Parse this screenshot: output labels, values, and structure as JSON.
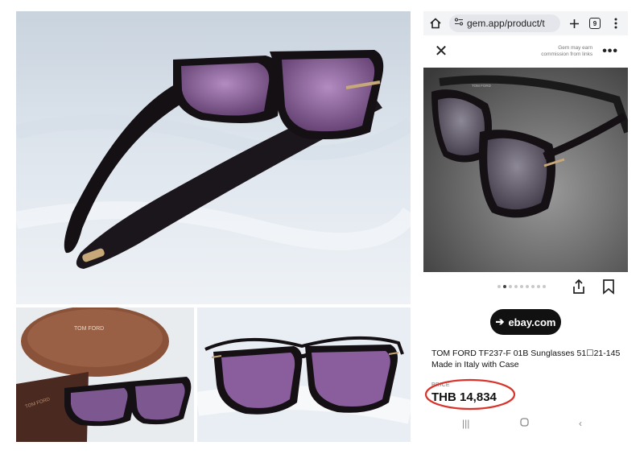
{
  "browser": {
    "url": "gem.app/product/t",
    "tab_count": "9"
  },
  "sheet": {
    "commission_line1": "Gem may earn",
    "commission_line2": "commission from links"
  },
  "carousel": {
    "dot_count": 9,
    "active_index": 1
  },
  "product": {
    "source_button": "ebay.com",
    "title_line1": "TOM FORD TF237-F 01B Sunglasses 51☐21-145",
    "title_line2": "Made in Italy with Case",
    "price_label": "PRICE",
    "price_value": "THB 14,834"
  },
  "case_photo": {
    "brand_text": "TOM FORD"
  },
  "colors": {
    "annotation_circle": "#d9342b",
    "frame": "#141014",
    "lens": "#6e4a7e",
    "case_brown": "#8a5238"
  }
}
